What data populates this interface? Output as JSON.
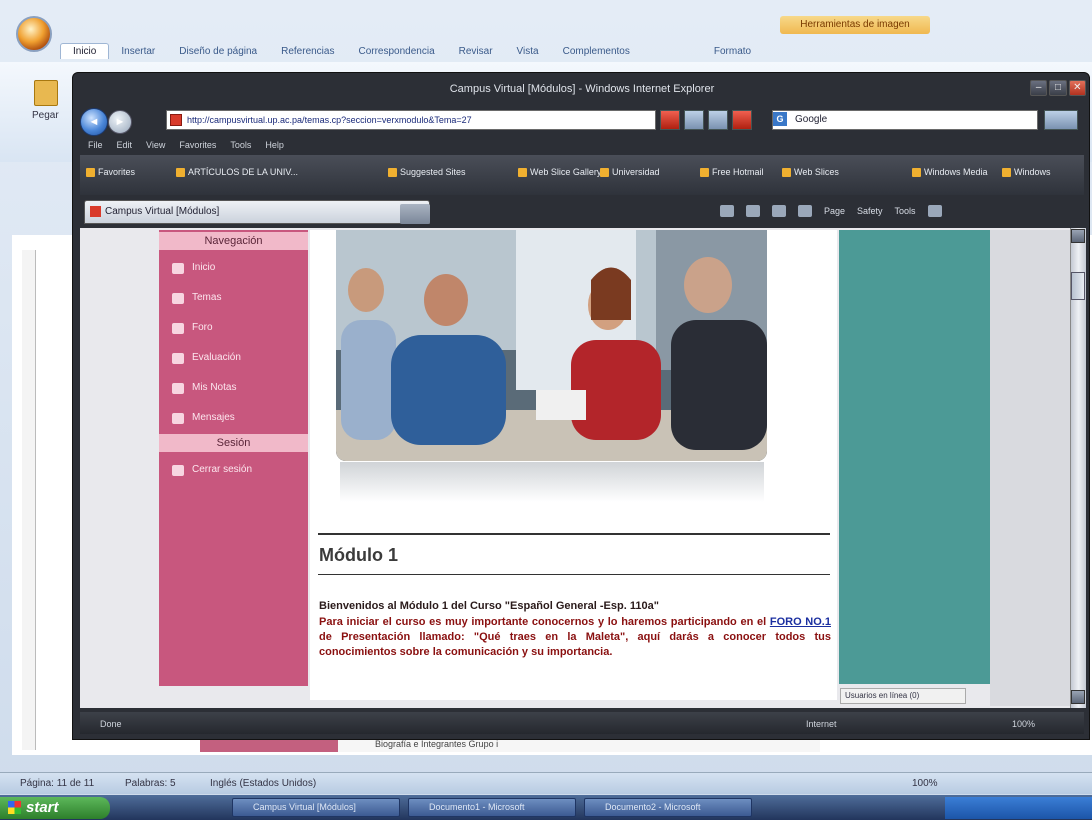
{
  "word": {
    "ribbon_tabs": [
      "Inicio",
      "Insertar",
      "Diseño de página",
      "Referencias",
      "Correspondencia",
      "Revisar",
      "Vista",
      "Complementos",
      "Formato"
    ],
    "contextual_tab": "Herramientas de imagen",
    "paste_label": "Pegar",
    "doc_strip_text": "Biografía e Integrantes Grupo i",
    "status": {
      "page": "Página: 11 de 11",
      "words": "Palabras: 5",
      "language": "Inglés (Estados Unidos)",
      "zoom": "100%"
    }
  },
  "taskbar": {
    "start_label": "start",
    "tasks": [
      "Campus Virtual [Módulos]",
      "Documento1 - Microsoft",
      "Documento2 - Microsoft"
    ],
    "clock": ""
  },
  "ie": {
    "title": "Campus Virtual [Módulos] - Windows Internet Explorer",
    "address": "http://campusvirtual.up.ac.pa/temas.cp?seccion=verxmodulo&Tema=27",
    "search_engine": "Google",
    "menu": [
      "File",
      "Edit",
      "View",
      "Favorites",
      "Tools",
      "Help"
    ],
    "favorites": [
      "Favorites",
      "ARTÍCULOS DE LA UNIV...",
      "Suggested Sites",
      "Web Slice Gallery",
      "Universidad",
      "Free Hotmail",
      "Web Slices",
      "Windows Media",
      "Windows"
    ],
    "tab_label": "Campus Virtual [Módulos]",
    "command_items": [
      "Page",
      "Safety",
      "Tools"
    ],
    "status_text": "Done",
    "status_zone": "Internet",
    "status_zoom": "100%"
  },
  "sidebar": {
    "section1": "Navegación",
    "items": [
      "Inicio",
      "Temas",
      "Foro",
      "Evaluación",
      "Mis Notas",
      "Mensajes"
    ],
    "section2": "Sesión",
    "logout": "Cerrar sesión"
  },
  "content": {
    "module_title": "Módulo 1",
    "welcome": "Bienvenidos al Módulo 1 del Curso \"Español General -Esp. 110a\"",
    "body_before": "Para iniciar el curso es muy importante conocernos y lo haremos participando en el ",
    "foro_link": "FORO NO.1",
    "body_after": " de Presentación llamado: \"Qué traes en la Maleta\", aquí darás a conocer todos tus conocimientos sobre la comunicación y su importancia."
  },
  "teal_status": "Usuarios en línea (0)",
  "colors": {
    "sidebar": "#c8577e",
    "sidebar_header": "#f1b9c9",
    "teal_panel": "#4c9a96",
    "body_text": "#8a1010",
    "link": "#1a2ea0"
  }
}
